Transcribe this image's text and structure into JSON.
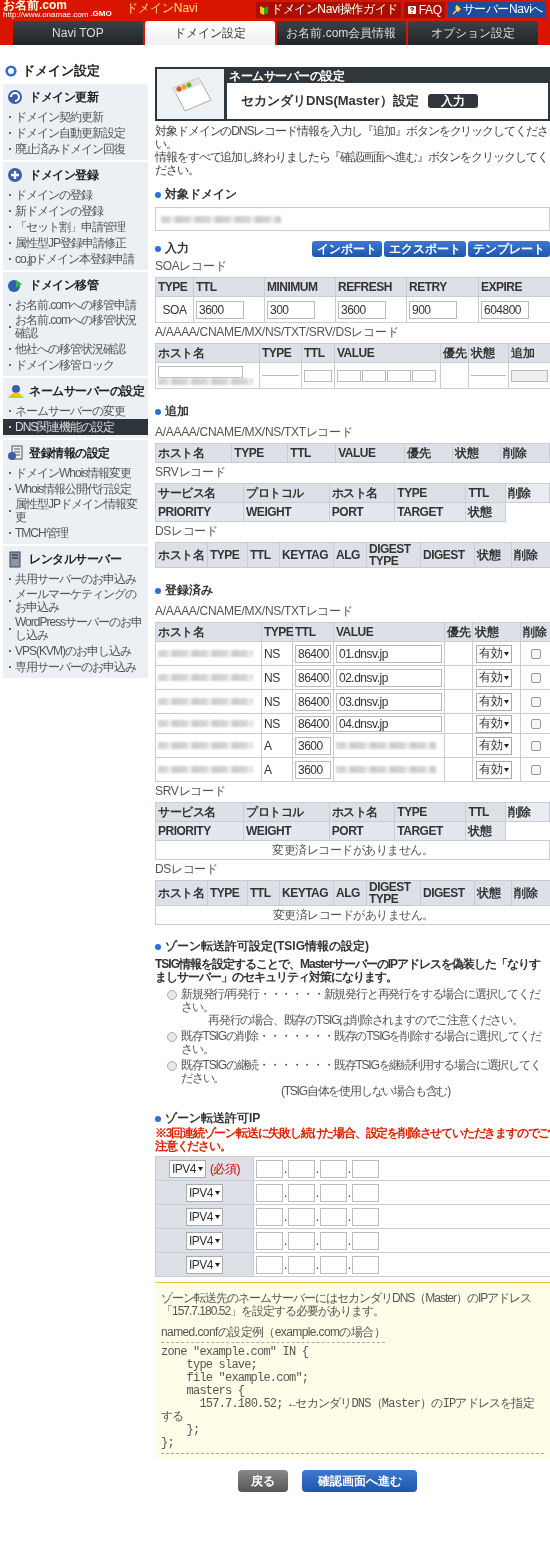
{
  "header": {
    "logo": "お名前.com",
    "logo_suffix": ".GMO",
    "logo_url": "http://www.onamae.com",
    "app_name": "ドメインNavi",
    "links": [
      {
        "label": "ドメインNavi操作ガイド",
        "kind": "guide"
      },
      {
        "label": "FAQ",
        "kind": "faq"
      },
      {
        "label": "サーバーNaviへ",
        "kind": "server"
      }
    ]
  },
  "tabs": [
    {
      "label": "Navi TOP",
      "selected": false
    },
    {
      "label": "ドメイン設定",
      "selected": true
    },
    {
      "label": "お名前.com会員情報",
      "selected": false
    },
    {
      "label": "オプション設定",
      "selected": false
    }
  ],
  "sidebar": {
    "title": "ドメイン設定",
    "groups": [
      {
        "title": "ドメイン更新",
        "items": [
          {
            "label": "ドメイン契約更新",
            "selected": false
          },
          {
            "label": "ドメイン自動更新設定",
            "selected": false
          },
          {
            "label": "廃止済みドメイン回復",
            "selected": false
          }
        ]
      },
      {
        "title": "ドメイン登録",
        "items": [
          {
            "label": "ドメインの登録",
            "selected": false
          },
          {
            "label": "新ドメインの登録",
            "selected": false
          },
          {
            "label": "「セット割」申請管理",
            "selected": false
          },
          {
            "label": "属性型JP登録申請修正",
            "selected": false
          },
          {
            "label": "co.jpドメイン本登録申請",
            "selected": false
          }
        ]
      },
      {
        "title": "ドメイン移管",
        "items": [
          {
            "label": "お名前.comへの移管申請",
            "selected": false
          },
          {
            "label": "お名前.comへの移管状況確認",
            "selected": false
          },
          {
            "label": "他社への移管状況確認",
            "selected": false
          },
          {
            "label": "ドメイン移管ロック",
            "selected": false
          }
        ]
      },
      {
        "title": "ネームサーバーの設定",
        "items": [
          {
            "label": "ネームサーバーの変更",
            "selected": false
          },
          {
            "label": "DNS関連機能の設定",
            "selected": true
          }
        ]
      },
      {
        "title": "登録情報の設定",
        "items": [
          {
            "label": "ドメインWhois情報変更",
            "selected": false
          },
          {
            "label": "Whois情報公開代行設定",
            "selected": false
          },
          {
            "label": "属性型JPドメイン情報変更",
            "selected": false
          },
          {
            "label": "TMCH管理",
            "selected": false
          }
        ]
      },
      {
        "title": "レンタルサーバー",
        "items": [
          {
            "label": "共用サーバーのお申込み",
            "selected": false
          },
          {
            "label": "メールマーケティングのお申込み",
            "selected": false
          },
          {
            "label": "WordPressサーバーのお申し込み",
            "selected": false
          },
          {
            "label": "VPS(KVM)のお申し込み",
            "selected": false
          },
          {
            "label": "専用サーバーのお申込み",
            "selected": false
          }
        ]
      }
    ]
  },
  "banner": {
    "category": "ネームサーバーの設定",
    "title": "セカンダリDNS(Master）設定",
    "step": "入力"
  },
  "intro": [
    "対象ドメインのDNSレコード情報を入力し『追加』ボタンをクリックしてください。",
    "情報をすべて追加し終わりましたら『確認画面へ進む』ボタンをクリックしてください。"
  ],
  "target_domain": {
    "heading": "対象ドメイン"
  },
  "input": {
    "heading": "入力",
    "buttons": [
      "インポート",
      "エクスポート",
      "テンプレート"
    ],
    "soa": {
      "caption": "SOAレコード",
      "columns": [
        "TYPE",
        "TTL",
        "MINIMUM",
        "REFRESH",
        "RETRY",
        "EXPIRE"
      ],
      "type": "SOA",
      "values": [
        "3600",
        "300",
        "3600",
        "900",
        "604800"
      ]
    },
    "records": {
      "caption": "A/AAAA/CNAME/MX/NS/TXT/SRV/DSレコード",
      "columns": [
        "ホスト名",
        "TYPE",
        "TTL",
        "VALUE",
        "優先",
        "状態",
        "追加"
      ]
    }
  },
  "added": {
    "heading": "追加",
    "records": {
      "caption": "A/AAAA/CNAME/MX/NS/TXTレコード",
      "columns": [
        "ホスト名",
        "TYPE",
        "TTL",
        "VALUE",
        "優先",
        "状態",
        "削除"
      ]
    },
    "srv": {
      "caption": "SRVレコード",
      "columns": [
        "サービス名",
        "プロトコル",
        "ホスト名",
        "TYPE",
        "TTL",
        "削除"
      ],
      "columns_2": [
        "PRIORITY",
        "WEIGHT",
        "PORT",
        "TARGET",
        "状態"
      ]
    },
    "ds": {
      "caption": "DSレコード",
      "columns": [
        "ホスト名",
        "TYPE",
        "TTL",
        "KEYTAG",
        "ALG",
        "DIGEST TYPE",
        "DIGEST",
        "状態",
        "削除"
      ]
    }
  },
  "registered": {
    "heading": "登録済み",
    "records": {
      "caption": "A/AAAA/CNAME/MX/NS/TXTレコード",
      "columns": [
        "ホスト名",
        "TYPE",
        "TTL",
        "VALUE",
        "優先",
        "状態",
        "削除"
      ],
      "rows": [
        {
          "type": "NS",
          "ttl": "86400",
          "value": "01.dnsv.jp",
          "status": "有効",
          "checked": false
        },
        {
          "type": "NS",
          "ttl": "86400",
          "value": "02.dnsv.jp",
          "status": "有効",
          "checked": false
        },
        {
          "type": "NS",
          "ttl": "86400",
          "value": "03.dnsv.jp",
          "status": "有効",
          "checked": false
        },
        {
          "type": "NS",
          "ttl": "86400",
          "value": "04.dnsv.jp",
          "status": "有効",
          "checked": false
        },
        {
          "type": "A",
          "ttl": "3600",
          "status": "有効",
          "checked": false
        },
        {
          "type": "A",
          "ttl": "3600",
          "status": "有効",
          "checked": false
        }
      ]
    },
    "srv": {
      "caption": "SRVレコード",
      "columns": [
        "サービス名",
        "プロトコル",
        "ホスト名",
        "TYPE",
        "TTL",
        "削除"
      ],
      "columns_2": [
        "PRIORITY",
        "WEIGHT",
        "PORT",
        "TARGET",
        "状態"
      ],
      "empty": "変更済レコードがありません。"
    },
    "ds": {
      "caption": "DSレコード",
      "columns": [
        "ホスト名",
        "TYPE",
        "TTL",
        "KEYTAG",
        "ALG",
        "DIGEST TYPE",
        "DIGEST",
        "状態",
        "削除"
      ],
      "empty": "変更済レコードがありません。"
    }
  },
  "tsig": {
    "heading": "ゾーン転送許可設定(TSIG情報の設定)",
    "description": "TSIG情報を設定することで、MasterサーバーのIPアドレスを偽装した「なりすましサーバー」のセキュリティ対策になります。",
    "options": [
      {
        "label": "新規発行/再発行・・・・・・新規発行と再発行をする場合に選択してください。",
        "note": "再発行の場合、既存のTSIGは削除されますのでご注意ください。",
        "selected": false
      },
      {
        "label": "既存TSIGの削除・・・・・・・既存のTSIGを削除する場合に選択してください。",
        "selected": false
      },
      {
        "label": "既存TSIGの継続・・・・・・・既存TSIGを継続利用する場合に選択してください。",
        "note": "(TSIG自体を使用しない場合も含む)",
        "selected": false
      }
    ]
  },
  "allowed_ip": {
    "heading": "ゾーン転送許可IP",
    "warning": "※3回連続ゾーン転送に失敗し続けた場合、設定を削除させていただきますのでご注意ください。",
    "rows": [
      {
        "protocol": "IPV4",
        "required": "(必須)",
        "separators": [
          ".",
          ".",
          "."
        ]
      },
      {
        "protocol": "IPV4",
        "separators": [
          ".",
          ".",
          "."
        ]
      },
      {
        "protocol": "IPV4",
        "separators": [
          ".",
          ".",
          "."
        ]
      },
      {
        "protocol": "IPV4",
        "separators": [
          ".",
          ".",
          "."
        ]
      },
      {
        "protocol": "IPV4",
        "separators": [
          ".",
          ".",
          "."
        ]
      }
    ]
  },
  "info": {
    "text": "ゾーン転送先のネームサーバーにはセカンダリDNS（Master）のIPアドレス「157.7.180.52」を設定する必要があります。",
    "code_title": "named.confの設定例（example.comの場合）",
    "code": "zone \"example.com\" IN {\n    type slave;\n    file \"example.com\";\n    masters {\n      157.7.180.52; ←セカンダリDNS（Master）のIPアドレスを指定する\n    };\n};"
  },
  "footer_buttons": [
    {
      "label": "戻る",
      "kind": "back"
    },
    {
      "label": "確認画面へ進む",
      "kind": "next"
    }
  ]
}
